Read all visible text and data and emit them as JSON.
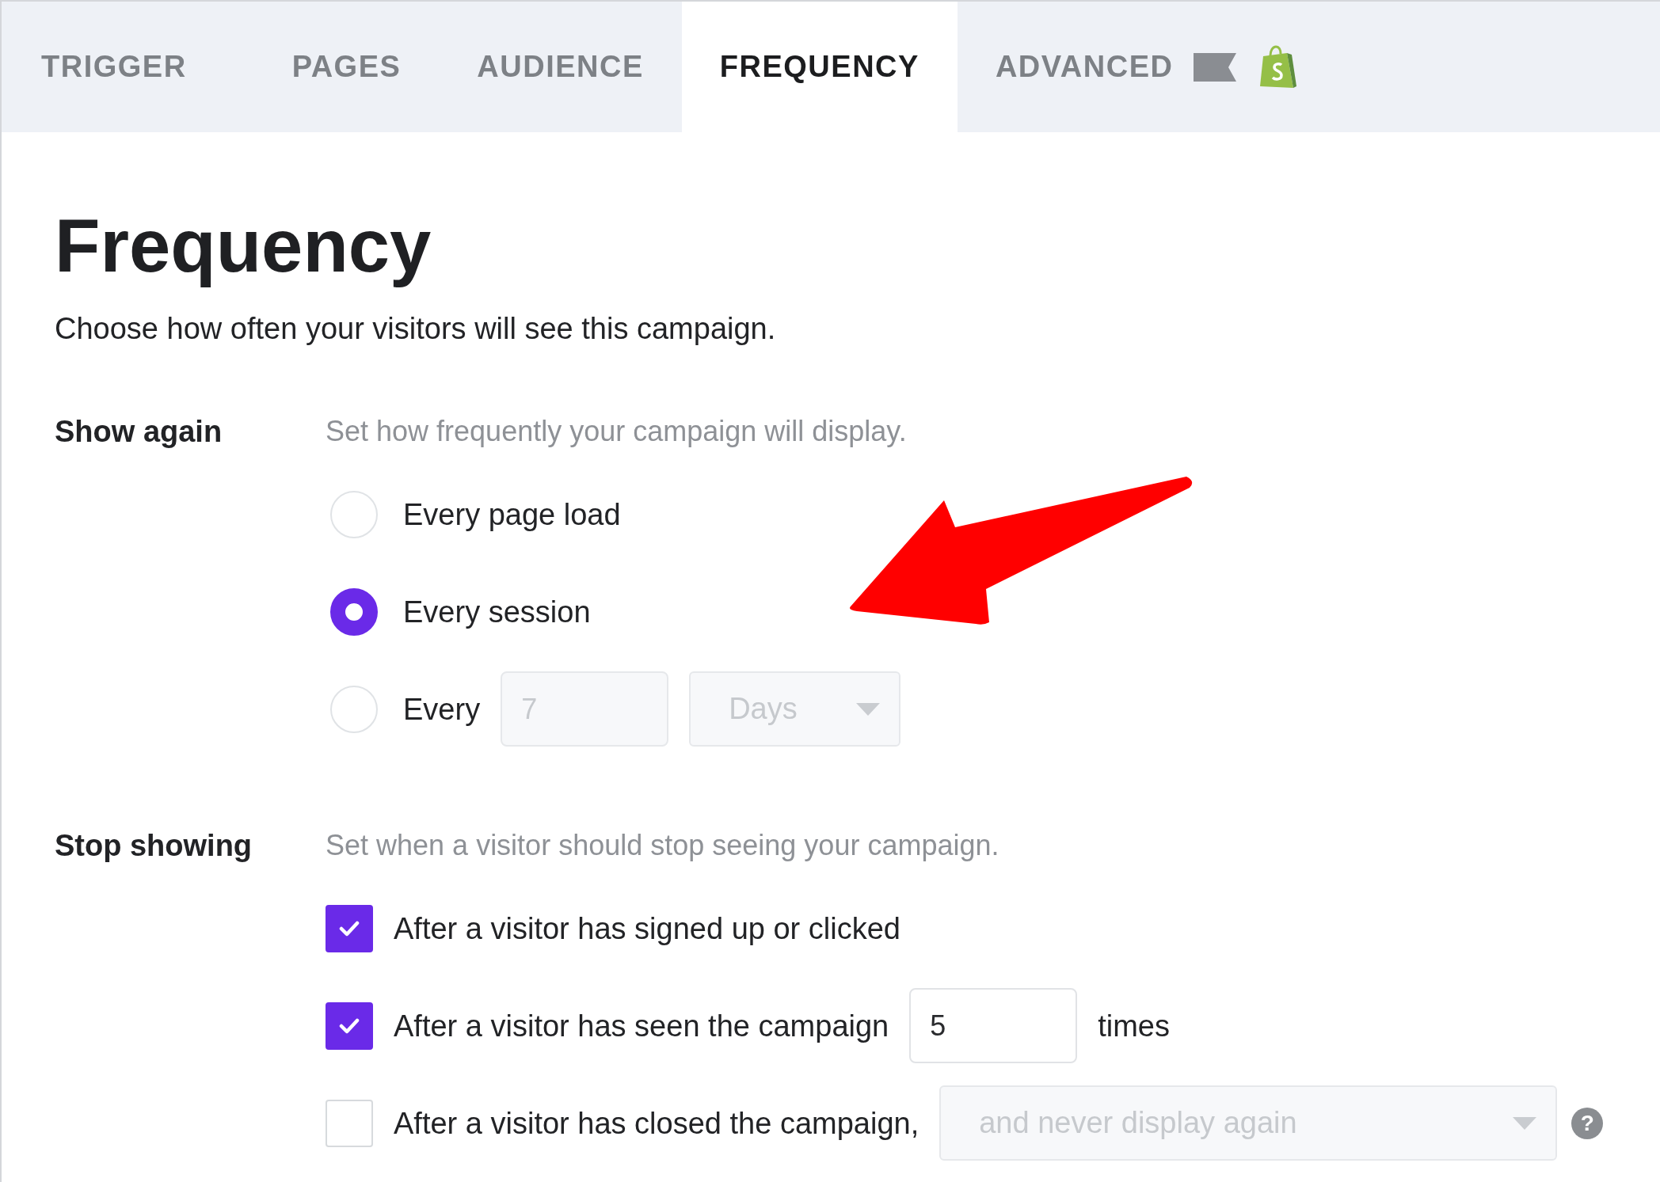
{
  "tabs": [
    {
      "label": "TRIGGER",
      "selected": false
    },
    {
      "label": "PAGES",
      "selected": false
    },
    {
      "label": "AUDIENCE",
      "selected": false
    },
    {
      "label": "FREQUENCY",
      "selected": true
    },
    {
      "label": "ADVANCED",
      "selected": false
    }
  ],
  "title": "Frequency",
  "subtitle": "Choose how often your visitors will see this campaign.",
  "sections": [
    {
      "label": "Show again",
      "description": "Set how frequently your campaign will display.",
      "options": [
        {
          "kind": "radio",
          "label": "Every page load",
          "selected": false
        },
        {
          "kind": "radio",
          "label": "Every session",
          "selected": true
        },
        {
          "kind": "radio",
          "label": "Every",
          "selected": false,
          "input": {
            "value": "7",
            "disabled": true
          },
          "select": {
            "value": "Days",
            "disabled": true
          }
        }
      ]
    },
    {
      "label": "Stop showing",
      "description": "Set when a visitor should stop seeing your campaign.",
      "options": [
        {
          "kind": "checkbox",
          "label": "After a visitor has signed up or clicked",
          "checked": true
        },
        {
          "kind": "checkbox",
          "label": "After a visitor has seen the campaign",
          "checked": true,
          "input": {
            "value": "5",
            "disabled": false
          },
          "suffix": "times"
        },
        {
          "kind": "checkbox",
          "label": "After a visitor has closed the campaign,",
          "checked": false,
          "select": {
            "value": "and never display again",
            "disabled": true
          },
          "help": "?"
        }
      ]
    }
  ]
}
